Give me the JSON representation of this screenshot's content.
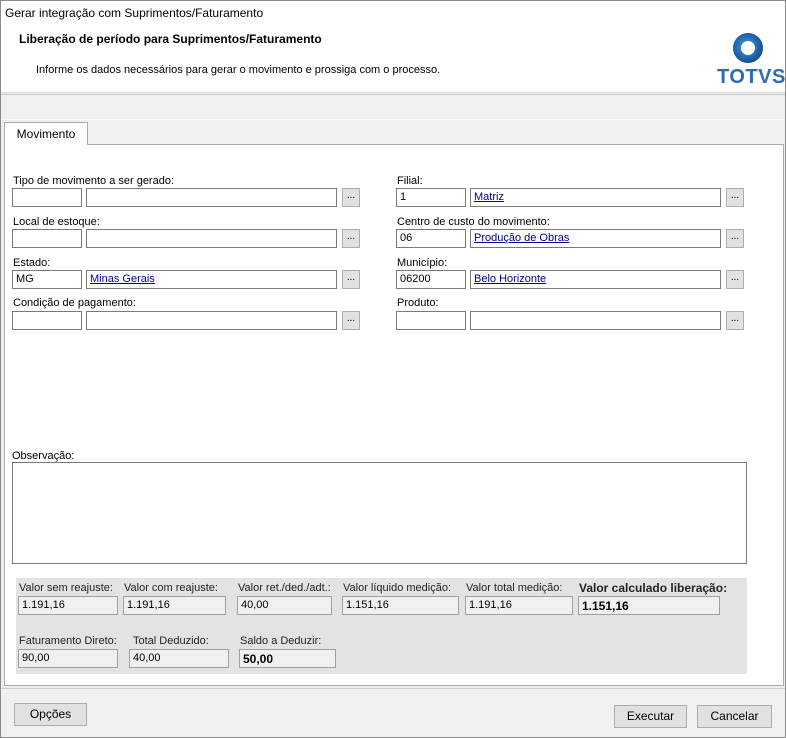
{
  "window": {
    "title": "Gerar integração com Suprimentos/Faturamento"
  },
  "header": {
    "title": "Liberação de período para Suprimentos/Faturamento",
    "subtitle": "Informe os dados necessários para gerar o movimento e prossiga com o processo.",
    "logo_text": "TOTVS"
  },
  "tabs": [
    {
      "label": "Movimento"
    }
  ],
  "form": {
    "tipo_movimento": {
      "label": "Tipo de movimento a ser gerado:",
      "code": "",
      "description": ""
    },
    "local_estoque": {
      "label": "Local de estoque:",
      "code": "",
      "description": ""
    },
    "estado": {
      "label": "Estado:",
      "code": "MG",
      "description": "Minas Gerais"
    },
    "condicao_pagamento": {
      "label": "Condição de pagamento:",
      "code": "",
      "description": ""
    },
    "filial": {
      "label": "Filial:",
      "code": "1",
      "description": "Matriz"
    },
    "centro_custo": {
      "label": "Centro de custo do movimento:",
      "code": "06",
      "description": "Produção de Obras"
    },
    "municipio": {
      "label": "Município:",
      "code": "06200",
      "description": "Belo Horizonte"
    },
    "produto": {
      "label": "Produto:",
      "code": "",
      "description": ""
    },
    "lookup_label": "...",
    "observacao": {
      "label": "Observação:",
      "value": ""
    }
  },
  "summary": {
    "valor_sem_reajuste": {
      "label": "Valor sem reajuste:",
      "value": "1.191,16"
    },
    "valor_com_reajuste": {
      "label": "Valor com reajuste:",
      "value": "1.191,16"
    },
    "valor_ret_ded_adt": {
      "label": "Valor ret./ded./adt.:",
      "value": "40,00"
    },
    "valor_liquido_medicao": {
      "label": "Valor líquido medição:",
      "value": "1.151,16"
    },
    "valor_total_medicao": {
      "label": "Valor total medição:",
      "value": "1.191,16"
    },
    "valor_calculado_liberacao": {
      "label": "Valor calculado liberação:",
      "value": "1.151,16"
    },
    "faturamento_direto": {
      "label": "Faturamento Direto:",
      "value": "90,00"
    },
    "total_deduzido": {
      "label": "Total Deduzido:",
      "value": "40,00"
    },
    "saldo_a_deduzir": {
      "label": "Saldo a Deduzir:",
      "value": "50,00"
    }
  },
  "footer": {
    "opcoes_label": "Opções",
    "executar_label": "Executar",
    "cancelar_label": "Cancelar"
  }
}
